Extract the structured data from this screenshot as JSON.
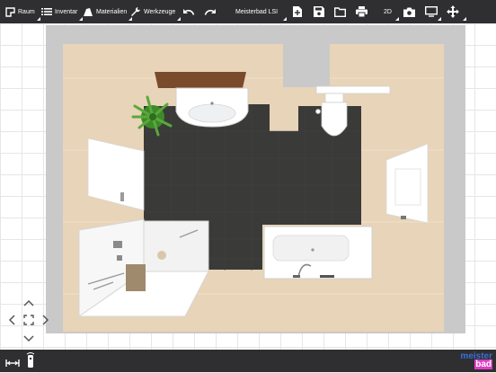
{
  "toolbar": {
    "raum": "Raum",
    "inventar": "Inventar",
    "materialien": "Materialien",
    "werkzeuge": "Werkzeuge",
    "project_title": "Meisterbad LSI",
    "view_mode": "2D"
  },
  "brand": {
    "line1": "meister",
    "line2": "bad"
  },
  "colors": {
    "toolbar_bg": "#2f2f31",
    "wall": "#c8c8c8",
    "floor_wood": "#e8d4b8",
    "floor_tile": "#3a3a38",
    "accent_brand": "#e03cc3"
  },
  "icons": [
    "room-icon",
    "list-icon",
    "paint-icon",
    "wrench-icon",
    "undo-icon",
    "redo-icon",
    "add-file-icon",
    "save-icon",
    "folder-icon",
    "print-icon",
    "camera-icon",
    "monitor-icon",
    "move-icon",
    "measure-icon",
    "remote-icon",
    "chevron-up-icon",
    "chevron-down-icon",
    "chevron-left-icon",
    "chevron-right-icon",
    "fit-screen-icon"
  ]
}
